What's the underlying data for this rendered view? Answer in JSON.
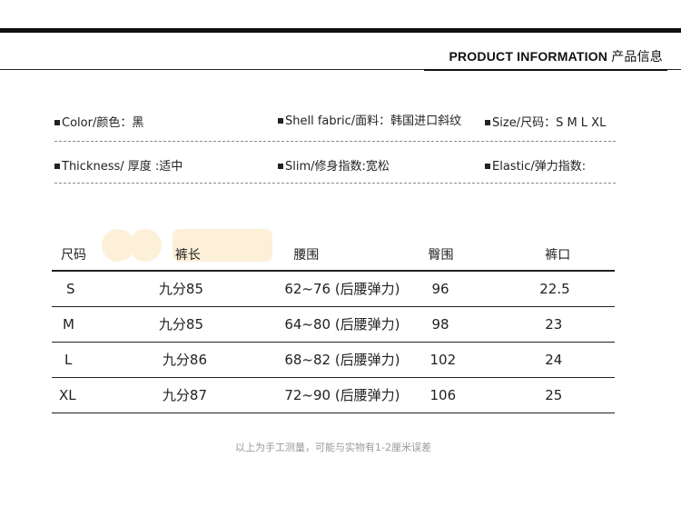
{
  "header": {
    "title_en": "PRODUCT INFORMATION",
    "title_cn": "产品信息"
  },
  "info": {
    "row1": [
      {
        "label": "Color/颜色：",
        "value": "黑"
      },
      {
        "label": "Shell fabric/面料：",
        "value": "韩国进口斜纹"
      },
      {
        "label": "Size/尺码：",
        "value": "S M L XL"
      }
    ],
    "row2": [
      {
        "label": "Thickness/ 厚度 :",
        "value": "适中"
      },
      {
        "label": "Slim/修身指数:",
        "value": "宽松"
      },
      {
        "label": "Elastic/弹力指数:",
        "value": ""
      }
    ]
  },
  "table": {
    "headers": [
      "尺码",
      "裤长",
      "腰围",
      "臀围",
      "裤口"
    ],
    "rows": [
      [
        "S",
        "九分85",
        "62~76 (后腰弹力)",
        "96",
        "22.5"
      ],
      [
        "M",
        "九分85",
        "64~80 (后腰弹力)",
        "98",
        "23"
      ],
      [
        "L",
        "九分86",
        "68~82 (后腰弹力)",
        "102",
        "24"
      ],
      [
        "XL",
        "九分87",
        "72~90 (后腰弹力)",
        "106",
        "25"
      ]
    ]
  },
  "note": "以上为手工测量，可能与实物有1-2厘米误差",
  "colors": {
    "text": "#222222",
    "note": "#9a9a9a",
    "rule": "#111111"
  }
}
